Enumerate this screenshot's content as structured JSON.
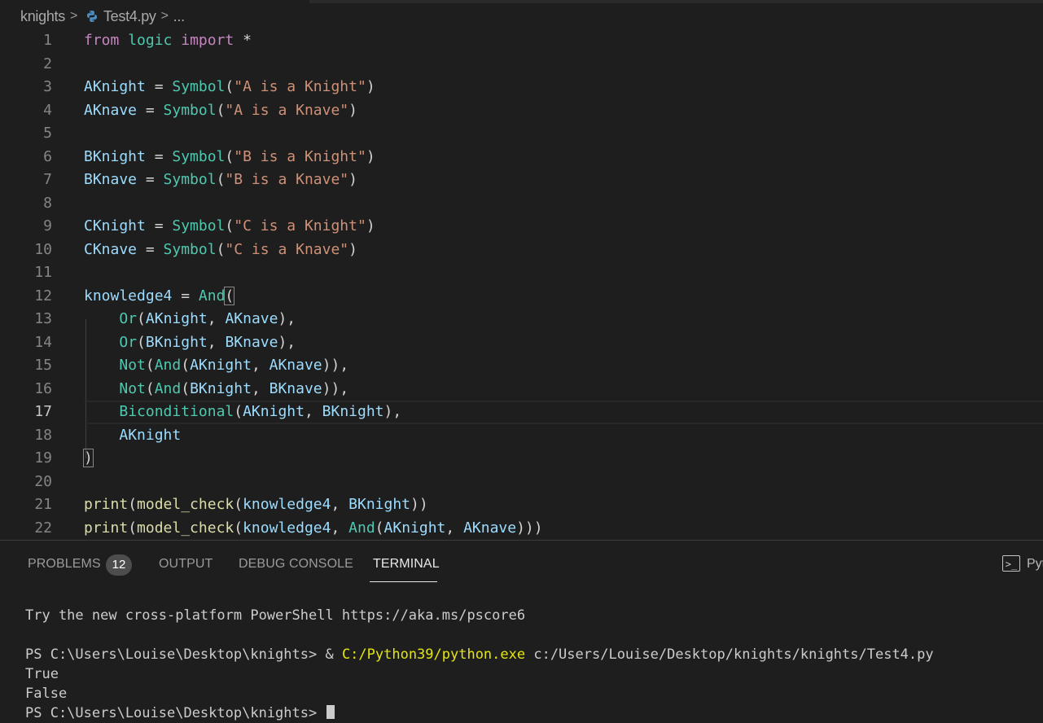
{
  "breadcrumb": {
    "folder": "knights",
    "file": "Test4.py",
    "more": "..."
  },
  "editor": {
    "active_line": 17,
    "lines": [
      {
        "n": "1",
        "t": [
          [
            "kw",
            "from"
          ],
          [
            "p",
            " "
          ],
          [
            "mod",
            "logic"
          ],
          [
            "p",
            " "
          ],
          [
            "kw",
            "import"
          ],
          [
            "p",
            " *"
          ]
        ]
      },
      {
        "n": "2",
        "t": []
      },
      {
        "n": "3",
        "t": [
          [
            "var",
            "AKnight"
          ],
          [
            "p",
            " = "
          ],
          [
            "fn",
            "Symbol"
          ],
          [
            "p",
            "("
          ],
          [
            "str",
            "\"A is a Knight\""
          ],
          [
            "p",
            ")"
          ]
        ]
      },
      {
        "n": "4",
        "t": [
          [
            "var",
            "AKnave"
          ],
          [
            "p",
            " = "
          ],
          [
            "fn",
            "Symbol"
          ],
          [
            "p",
            "("
          ],
          [
            "str",
            "\"A is a Knave\""
          ],
          [
            "p",
            ")"
          ]
        ]
      },
      {
        "n": "5",
        "t": []
      },
      {
        "n": "6",
        "t": [
          [
            "var",
            "BKnight"
          ],
          [
            "p",
            " = "
          ],
          [
            "fn",
            "Symbol"
          ],
          [
            "p",
            "("
          ],
          [
            "str",
            "\"B is a Knight\""
          ],
          [
            "p",
            ")"
          ]
        ]
      },
      {
        "n": "7",
        "t": [
          [
            "var",
            "BKnave"
          ],
          [
            "p",
            " = "
          ],
          [
            "fn",
            "Symbol"
          ],
          [
            "p",
            "("
          ],
          [
            "str",
            "\"B is a Knave\""
          ],
          [
            "p",
            ")"
          ]
        ]
      },
      {
        "n": "8",
        "t": []
      },
      {
        "n": "9",
        "t": [
          [
            "var",
            "CKnight"
          ],
          [
            "p",
            " = "
          ],
          [
            "fn",
            "Symbol"
          ],
          [
            "p",
            "("
          ],
          [
            "str",
            "\"C is a Knight\""
          ],
          [
            "p",
            ")"
          ]
        ]
      },
      {
        "n": "10",
        "t": [
          [
            "var",
            "CKnave"
          ],
          [
            "p",
            " = "
          ],
          [
            "fn",
            "Symbol"
          ],
          [
            "p",
            "("
          ],
          [
            "str",
            "\"C is a Knave\""
          ],
          [
            "p",
            ")"
          ]
        ]
      },
      {
        "n": "11",
        "t": []
      },
      {
        "n": "12",
        "t": [
          [
            "var",
            "knowledge4"
          ],
          [
            "p",
            " = "
          ],
          [
            "fn",
            "And"
          ],
          [
            "brk",
            "("
          ]
        ]
      },
      {
        "n": "13",
        "t": [
          [
            "p",
            "    "
          ],
          [
            "fn",
            "Or"
          ],
          [
            "p",
            "("
          ],
          [
            "var",
            "AKnight"
          ],
          [
            "p",
            ", "
          ],
          [
            "var",
            "AKnave"
          ],
          [
            "p",
            "),"
          ]
        ]
      },
      {
        "n": "14",
        "t": [
          [
            "p",
            "    "
          ],
          [
            "fn",
            "Or"
          ],
          [
            "p",
            "("
          ],
          [
            "var",
            "BKnight"
          ],
          [
            "p",
            ", "
          ],
          [
            "var",
            "BKnave"
          ],
          [
            "p",
            "),"
          ]
        ]
      },
      {
        "n": "15",
        "t": [
          [
            "p",
            "    "
          ],
          [
            "fn",
            "Not"
          ],
          [
            "p",
            "("
          ],
          [
            "fn",
            "And"
          ],
          [
            "p",
            "("
          ],
          [
            "var",
            "AKnight"
          ],
          [
            "p",
            ", "
          ],
          [
            "var",
            "AKnave"
          ],
          [
            "p",
            ")),"
          ]
        ]
      },
      {
        "n": "16",
        "t": [
          [
            "p",
            "    "
          ],
          [
            "fn",
            "Not"
          ],
          [
            "p",
            "("
          ],
          [
            "fn",
            "And"
          ],
          [
            "p",
            "("
          ],
          [
            "var",
            "BKnight"
          ],
          [
            "p",
            ", "
          ],
          [
            "var",
            "BKnave"
          ],
          [
            "p",
            ")),"
          ]
        ]
      },
      {
        "n": "17",
        "t": [
          [
            "p",
            "    "
          ],
          [
            "fn",
            "Biconditional"
          ],
          [
            "p",
            "("
          ],
          [
            "var",
            "AKnight"
          ],
          [
            "p",
            ", "
          ],
          [
            "var",
            "BKnight"
          ],
          [
            "p",
            "),"
          ]
        ]
      },
      {
        "n": "18",
        "t": [
          [
            "p",
            "    "
          ],
          [
            "var",
            "AKnight"
          ]
        ]
      },
      {
        "n": "19",
        "t": [
          [
            "brk",
            ")"
          ]
        ]
      },
      {
        "n": "20",
        "t": []
      },
      {
        "n": "21",
        "t": [
          [
            "fnc",
            "print"
          ],
          [
            "p",
            "("
          ],
          [
            "fnc",
            "model_check"
          ],
          [
            "p",
            "("
          ],
          [
            "var",
            "knowledge4"
          ],
          [
            "p",
            ", "
          ],
          [
            "var",
            "BKnight"
          ],
          [
            "p",
            "))"
          ]
        ]
      },
      {
        "n": "22",
        "t": [
          [
            "fnc",
            "print"
          ],
          [
            "p",
            "("
          ],
          [
            "fnc",
            "model_check"
          ],
          [
            "p",
            "("
          ],
          [
            "var",
            "knowledge4"
          ],
          [
            "p",
            ", "
          ],
          [
            "fn",
            "And"
          ],
          [
            "p",
            "("
          ],
          [
            "var",
            "AKnight"
          ],
          [
            "p",
            ", "
          ],
          [
            "var",
            "AKnave"
          ],
          [
            "p",
            ")))"
          ]
        ]
      }
    ]
  },
  "panel": {
    "tabs": {
      "problems": "PROBLEMS",
      "problems_count": "12",
      "output": "OUTPUT",
      "debug": "DEBUG CONSOLE",
      "terminal": "TERMINAL"
    },
    "terminal_label": "Pyt"
  },
  "terminal": {
    "banner": "Try the new cross-platform PowerShell https://aka.ms/pscore6",
    "prompt1": "PS C:\\Users\\Louise\\Desktop\\knights> & ",
    "exe": "C:/Python39/python.exe",
    "script": " c:/Users/Louise/Desktop/knights/knights/Test4.py",
    "out1": "True",
    "out2": "False",
    "prompt2": "PS C:\\Users\\Louise\\Desktop\\knights> "
  },
  "colors": {
    "background": "#1e1e1e",
    "keyword": "#c586c0",
    "variable": "#9cdcfe",
    "class": "#4ec9b0",
    "function": "#dcdcaa",
    "string": "#ce9178",
    "terminal_exe": "#e5e510"
  }
}
